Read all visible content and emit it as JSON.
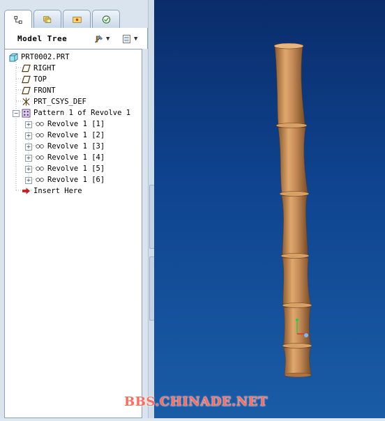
{
  "panel": {
    "title": "Model Tree"
  },
  "tabs": [
    {
      "name": "model-tree",
      "active": true
    },
    {
      "name": "folder-browser",
      "active": false
    },
    {
      "name": "favorites",
      "active": false
    },
    {
      "name": "connections",
      "active": false
    }
  ],
  "tree": {
    "root": "PRT0002.PRT",
    "items": [
      {
        "label": "RIGHT",
        "icon": "datum-plane-icon"
      },
      {
        "label": "TOP",
        "icon": "datum-plane-icon"
      },
      {
        "label": "FRONT",
        "icon": "datum-plane-icon"
      },
      {
        "label": "PRT_CSYS_DEF",
        "icon": "csys-icon"
      },
      {
        "label": "Pattern 1 of Revolve 1",
        "icon": "pattern-icon"
      },
      {
        "label": "Revolve 1 [1]",
        "icon": "revolve-icon"
      },
      {
        "label": "Revolve 1 [2]",
        "icon": "revolve-icon"
      },
      {
        "label": "Revolve 1 [3]",
        "icon": "revolve-icon"
      },
      {
        "label": "Revolve 1 [4]",
        "icon": "revolve-icon"
      },
      {
        "label": "Revolve 1 [5]",
        "icon": "revolve-icon"
      },
      {
        "label": "Revolve 1 [6]",
        "icon": "revolve-icon"
      },
      {
        "label": "Insert Here",
        "icon": "insert-arrow-icon"
      }
    ]
  },
  "watermark": "BBS.CHINADE.NET",
  "colors": {
    "viewport_top": "#0a2c6a",
    "viewport_bottom": "#1a5ca6",
    "model": "#c48a57",
    "watermark": "#ff6a5a"
  }
}
